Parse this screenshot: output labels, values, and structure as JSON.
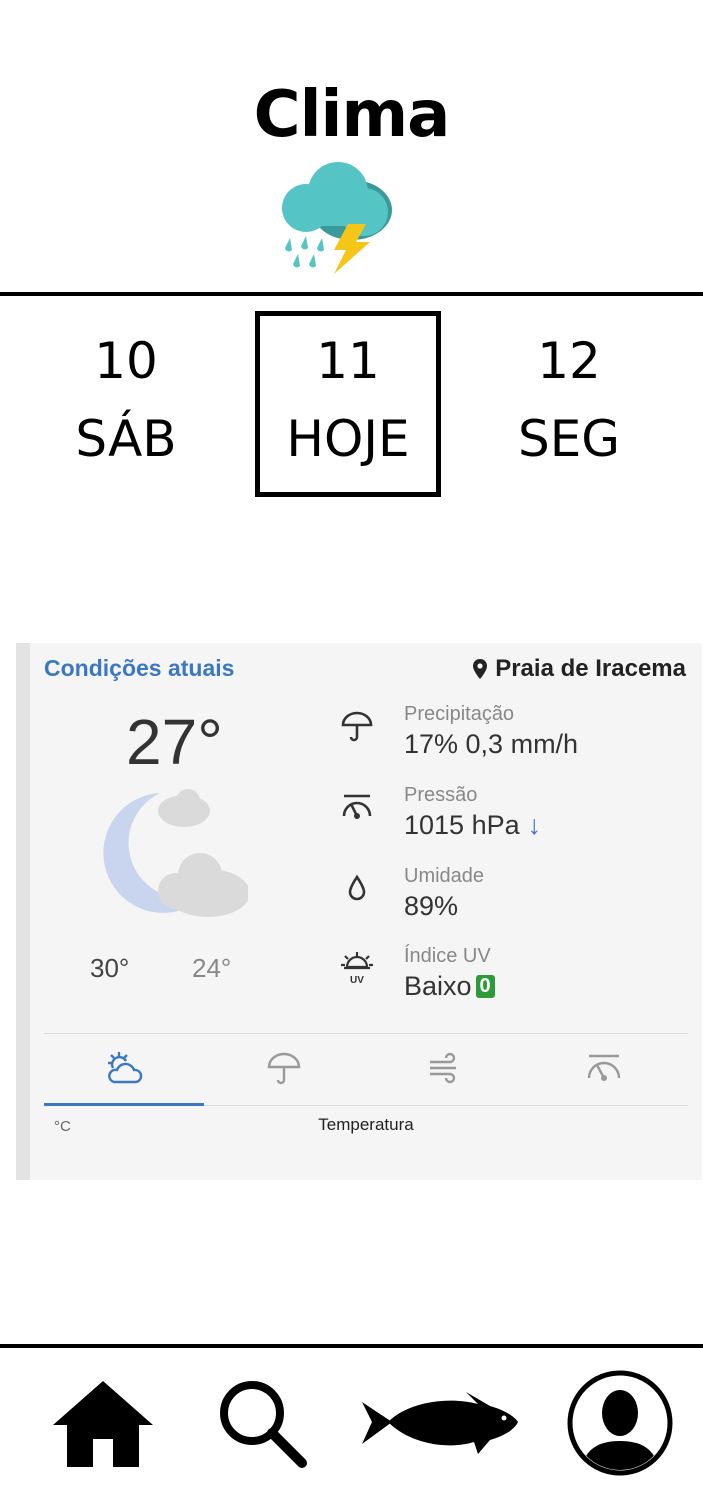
{
  "app": {
    "title": "Clima",
    "header_icon": "thunderstorm-rain-icon"
  },
  "days": [
    {
      "number": "10",
      "label": "SÁB",
      "selected": false
    },
    {
      "number": "11",
      "label": "HOJE",
      "selected": true
    },
    {
      "number": "12",
      "label": "SEG",
      "selected": false
    }
  ],
  "weather_card": {
    "section_title": "Condições atuais",
    "location": "Praia de Iracema",
    "current_temp": "27°",
    "condition_icon": "moon-cloud-icon",
    "max_temp": "30°",
    "min_temp": "24°",
    "metrics": [
      {
        "icon": "umbrella-icon",
        "label": "Precipitação",
        "value": "17%  0,3 mm/h"
      },
      {
        "icon": "pressure-gauge-icon",
        "label": "Pressão",
        "value": "1015 hPa",
        "trend": "↓"
      },
      {
        "icon": "droplet-icon",
        "label": "Umidade",
        "value": "89%"
      },
      {
        "icon": "uv-sun-icon",
        "label": "Índice UV",
        "value": "Baixo",
        "badge": "0"
      }
    ],
    "tabs": [
      {
        "icon": "sun-cloud-icon",
        "active": true
      },
      {
        "icon": "umbrella-icon",
        "active": false
      },
      {
        "icon": "wind-icon",
        "active": false
      },
      {
        "icon": "pressure-gauge-icon",
        "active": false
      }
    ],
    "unit_label": "°C",
    "chart_title": "Temperatura"
  },
  "colors": {
    "accent_blue": "#3b78c2",
    "uv_green": "#2e9a3c",
    "storm_cloud": "#55c4c4",
    "bolt": "#f5c518"
  },
  "bottom_nav": [
    {
      "icon": "home-icon"
    },
    {
      "icon": "search-icon"
    },
    {
      "icon": "fish-icon"
    },
    {
      "icon": "profile-avatar-icon"
    }
  ]
}
